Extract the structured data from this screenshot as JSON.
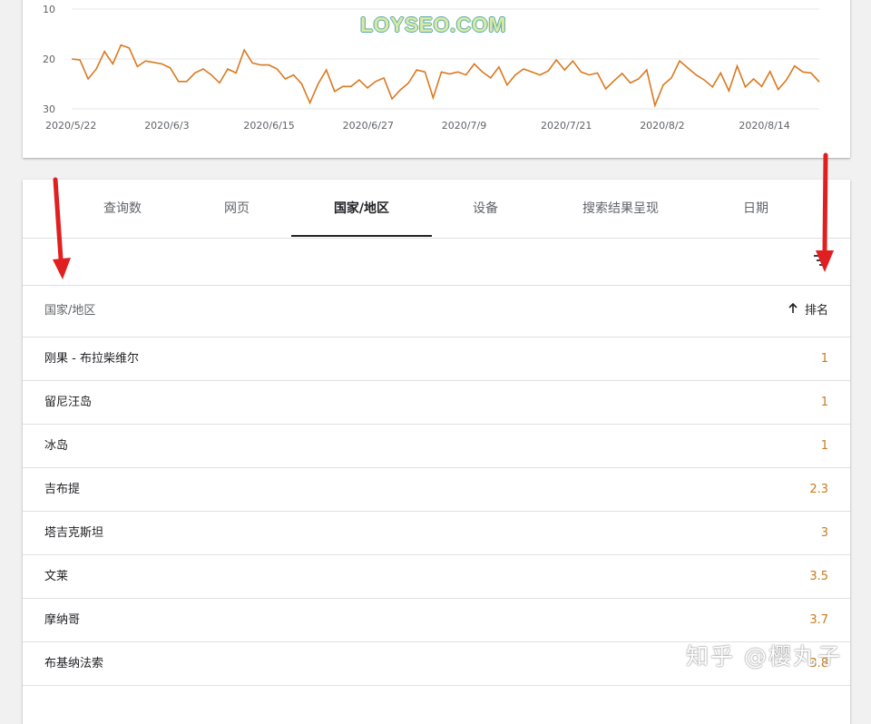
{
  "chart_data": {
    "type": "line",
    "series_color": "#d9791f",
    "y_reversed": true,
    "ylim": [
      10,
      30
    ],
    "yticks": [
      "10",
      "20",
      "30"
    ],
    "xticks": [
      "2020/5/22",
      "2020/6/3",
      "2020/6/15",
      "2020/6/27",
      "2020/7/9",
      "2020/7/21",
      "2020/8/2",
      "2020/8/14"
    ],
    "values": [
      20,
      20.2,
      24,
      22,
      18.5,
      21,
      17.2,
      17.8,
      21.5,
      20.4,
      20.7,
      21,
      21.8,
      24.5,
      24.5,
      22.8,
      22,
      23.2,
      24.8,
      22,
      22.8,
      18.2,
      20.8,
      21.2,
      21.2,
      22,
      24,
      23.2,
      25,
      28.8,
      25,
      22.2,
      26.5,
      25.5,
      25.5,
      24.2,
      25.8,
      24.5,
      23.8,
      28,
      26.2,
      24.8,
      22.2,
      22.6,
      27.8,
      22.6,
      23,
      22.6,
      23.2,
      21,
      22.6,
      23.8,
      21.6,
      25.2,
      23.2,
      22,
      22.6,
      23.2,
      22.4,
      20.2,
      22.2,
      20.4,
      22.6,
      23.2,
      22.8,
      26,
      24.4,
      22.9,
      24.8,
      24,
      22.2,
      29.3,
      25.2,
      23.8,
      20.4,
      21.8,
      23.2,
      24.2,
      25.6,
      22.8,
      26.4,
      21.4,
      25.6,
      24,
      25.5,
      22.5,
      26.1,
      24.2,
      21.4,
      22.6,
      22.8,
      24.6
    ]
  },
  "watermark_logo": "LOYSEO.COM",
  "tabs": [
    {
      "label": "查询数"
    },
    {
      "label": "网页"
    },
    {
      "label": "国家/地区"
    },
    {
      "label": "设备"
    },
    {
      "label": "搜索结果呈现"
    },
    {
      "label": "日期"
    }
  ],
  "active_tab": "国家/地区",
  "toolbar": {
    "filter_icon": "filter-icon"
  },
  "table": {
    "header_country": "国家/地区",
    "header_rank": "排名",
    "sort_icon": "arrow-up-icon",
    "rows": [
      {
        "country": "刚果 - 布拉柴维尔",
        "rank": "1"
      },
      {
        "country": "留尼汪岛",
        "rank": "1"
      },
      {
        "country": "冰岛",
        "rank": "1"
      },
      {
        "country": "吉布提",
        "rank": "2.3"
      },
      {
        "country": "塔吉克斯坦",
        "rank": "3"
      },
      {
        "country": "文莱",
        "rank": "3.5"
      },
      {
        "country": "摩纳哥",
        "rank": "3.7"
      },
      {
        "country": "布基纳法索",
        "rank": "3.8"
      }
    ]
  },
  "annotation_color": "#e02020",
  "zhihu_watermark": "知乎 @樱丸子"
}
